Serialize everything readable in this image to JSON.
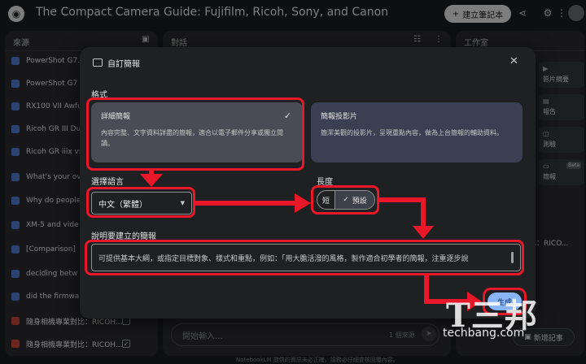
{
  "app": {
    "title": "The Compact Camera Guide: Fujifilm, Ricoh, Sony, and Canon",
    "create_notebook_label": "建立筆記本"
  },
  "sources_panel": {
    "title": "來源",
    "items": [
      {
        "label": "PowerShot G7...",
        "icon": "doc-icon"
      },
      {
        "label": "PowerShot G7",
        "icon": "doc-icon"
      },
      {
        "label": "RX100 VII Awfu",
        "icon": "doc-icon"
      },
      {
        "label": "Ricoh GR III Du",
        "icon": "doc-icon"
      },
      {
        "label": "Ricoh GR iiix vs",
        "icon": "doc-icon"
      },
      {
        "label": "What's your ov",
        "icon": "doc-icon"
      },
      {
        "label": "Why do people",
        "icon": "doc-icon"
      },
      {
        "label": "XM-5 and vide",
        "icon": "doc-icon"
      },
      {
        "label": "[Comparison]",
        "icon": "doc-icon"
      },
      {
        "label": "deciding betw",
        "icon": "doc-icon"
      },
      {
        "label": "did the firmwa",
        "icon": "doc-icon"
      },
      {
        "label": "隨身相機專業對比：RICOH...",
        "icon": "slides-icon"
      },
      {
        "label": "隨身相機專業對比：RICOH...",
        "icon": "slides-icon"
      }
    ]
  },
  "chat_panel": {
    "title": "對話",
    "input_placeholder": "開始輸入...",
    "source_count": "1 個來源",
    "footer": "NotebookLM 提供的資訊未必正確，請務必仔細查核回覆內容。"
  },
  "studio_panel": {
    "title": "工作室",
    "cards": [
      {
        "label": "影片摘要",
        "icon": "video-icon"
      },
      {
        "label": "報告",
        "icon": "report-icon"
      },
      {
        "label": "測驗",
        "icon": "quiz-icon"
      },
      {
        "label": "簡報",
        "icon": "slides-icon",
        "badge": "Beta"
      }
    ],
    "item_snippet": "比：RICO...",
    "new_note_label": "新增記事"
  },
  "dialog": {
    "title": "自訂簡報",
    "format_label": "格式",
    "formats": [
      {
        "name": "詳細簡報",
        "desc": "內容完整、文字資料詳盡的簡報，適合以電子郵件分享或獨立閱讀。",
        "selected": true
      },
      {
        "name": "簡報投影片",
        "desc": "簡潔美觀的投影片，呈現重點內容，做為上台簡報的輔助資料。",
        "selected": false
      }
    ],
    "language_label": "選擇語言",
    "language_value": "中文（繁體）",
    "length_label": "長度",
    "length_options": [
      "短",
      "預設"
    ],
    "length_selected": "預設",
    "describe_label": "說明要建立的簡報",
    "describe_placeholder": "可提供基本大綱，或指定目標對象、樣式和重點，例如：「用大膽活潑的風格，製作適合初學者的簡報，注重逐步說",
    "generate_label": "生成"
  },
  "watermark": {
    "big": "T三邦",
    "small": "techbang.com"
  },
  "colors": {
    "annotation_red": "#e8182a",
    "primary_button": "#8ab4f8",
    "selected_card": "#4a4b54"
  }
}
